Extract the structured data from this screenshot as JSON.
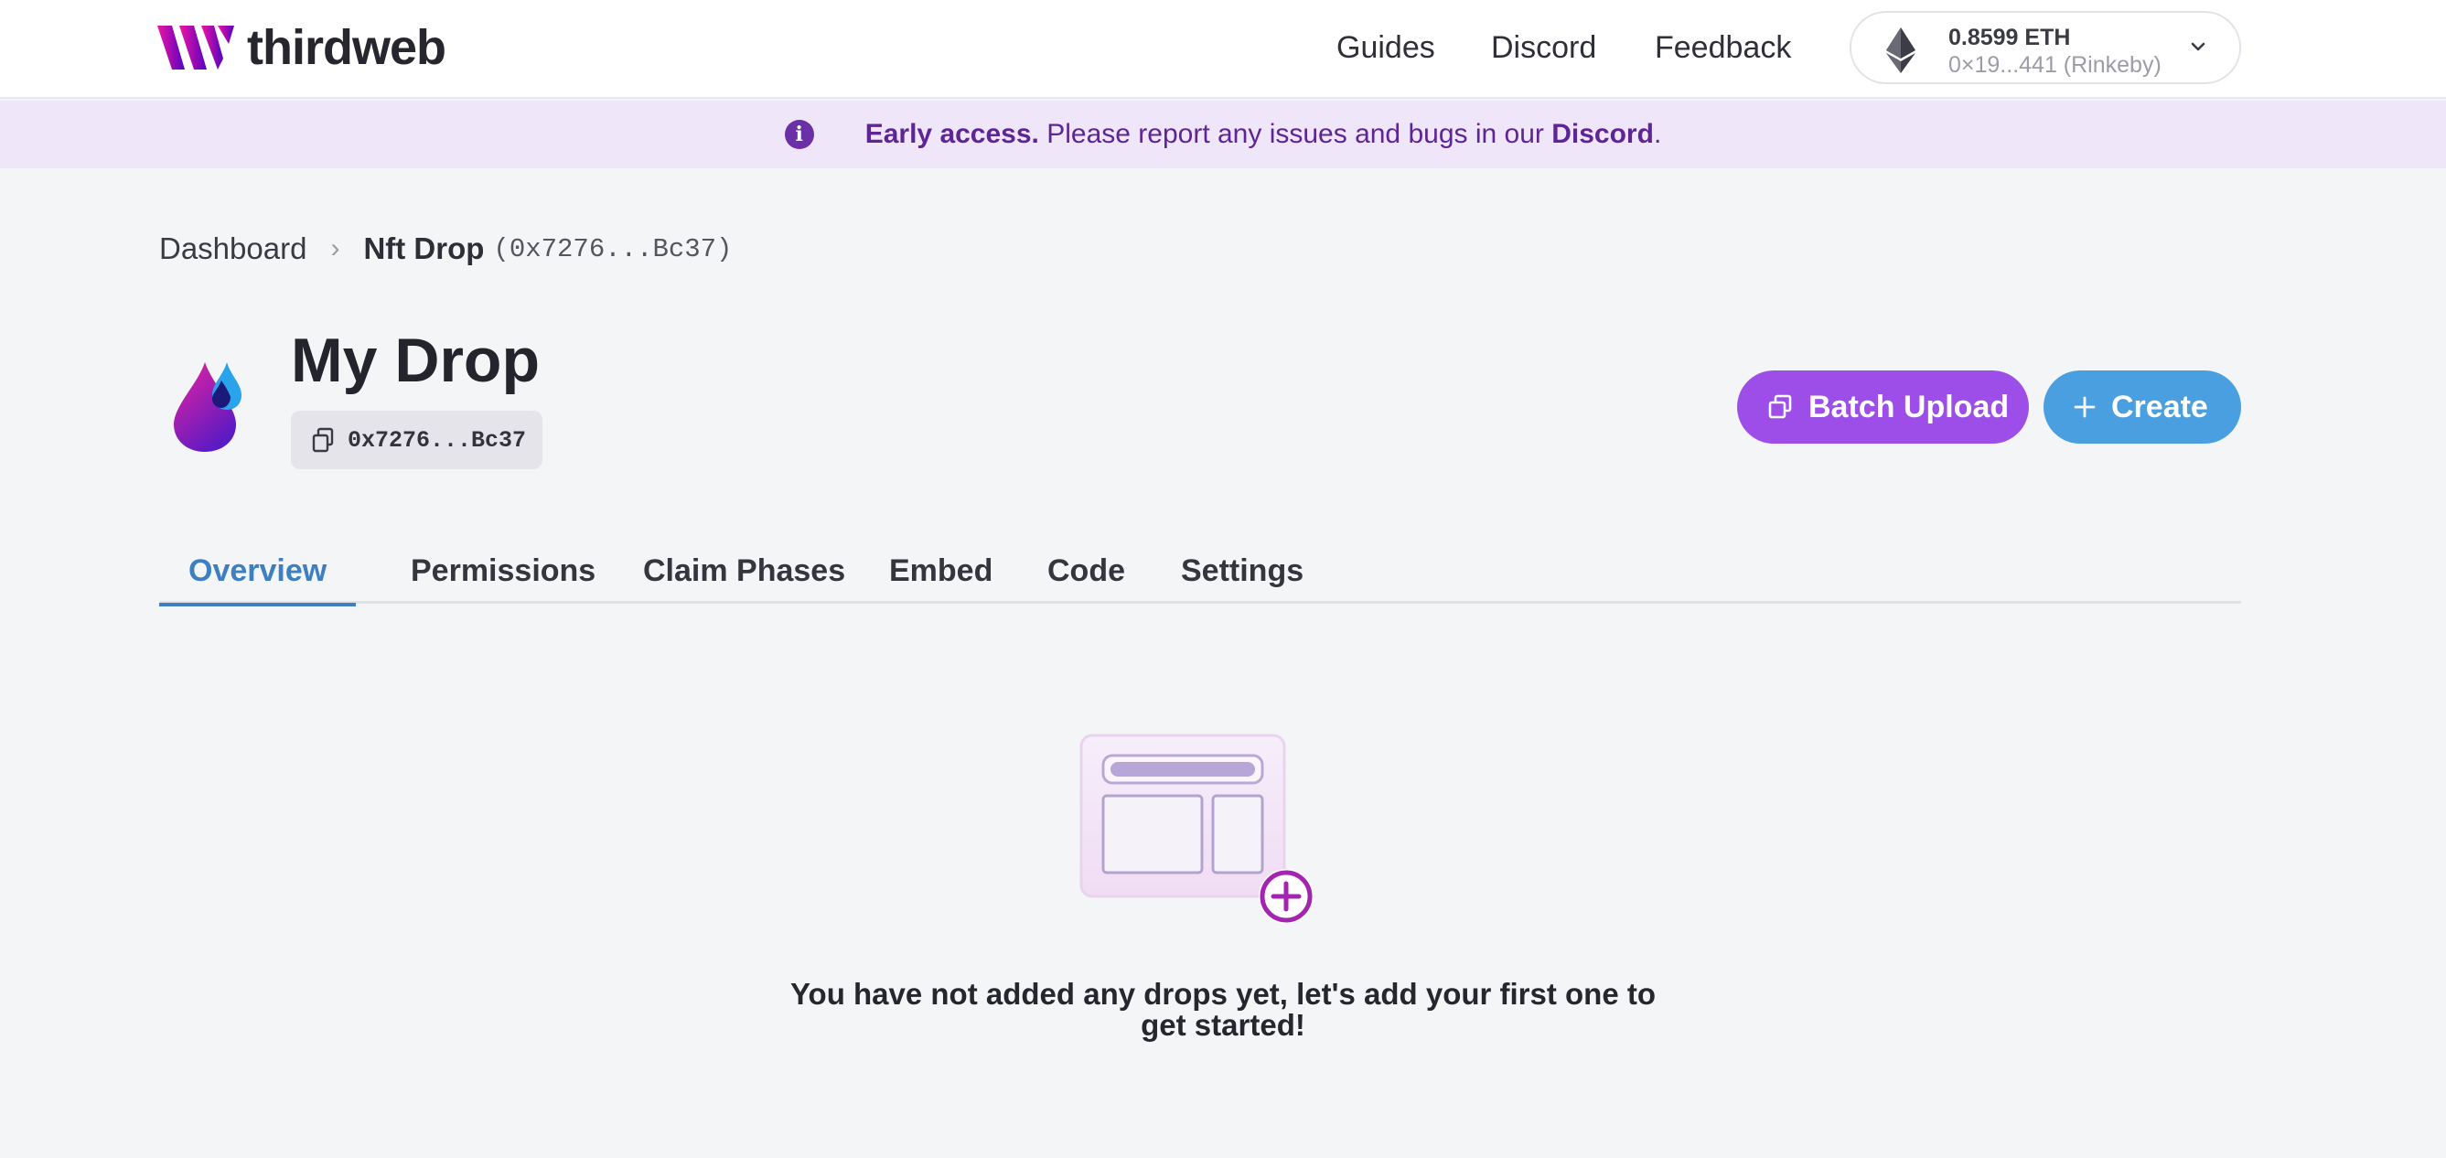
{
  "header": {
    "brand": "thirdweb",
    "nav": [
      "Guides",
      "Discord",
      "Feedback"
    ],
    "wallet": {
      "balance": "0.8599 ETH",
      "address": "0×19...441 (Rinkeby)"
    }
  },
  "banner": {
    "bold": "Early access.",
    "message": " Please report any issues and bugs in our ",
    "link": "Discord",
    "end": "."
  },
  "breadcrumb": {
    "root": "Dashboard",
    "current": "Nft Drop",
    "address": "(0x7276...Bc37)"
  },
  "contract": {
    "title": "My Drop",
    "address": "0x7276...Bc37"
  },
  "actions": {
    "batch_upload": "Batch Upload",
    "create": "Create"
  },
  "tabs": [
    "Overview",
    "Permissions",
    "Claim Phases",
    "Embed",
    "Code",
    "Settings"
  ],
  "active_tab": "Overview",
  "empty_state": {
    "message": "You have not added any drops yet, let's add your first one to get started!"
  },
  "colors": {
    "brand_purple": "#9d4de8",
    "create_blue": "#4a9fe0",
    "active_tab": "#3d7fc0",
    "banner_bg": "#efe6fa"
  }
}
